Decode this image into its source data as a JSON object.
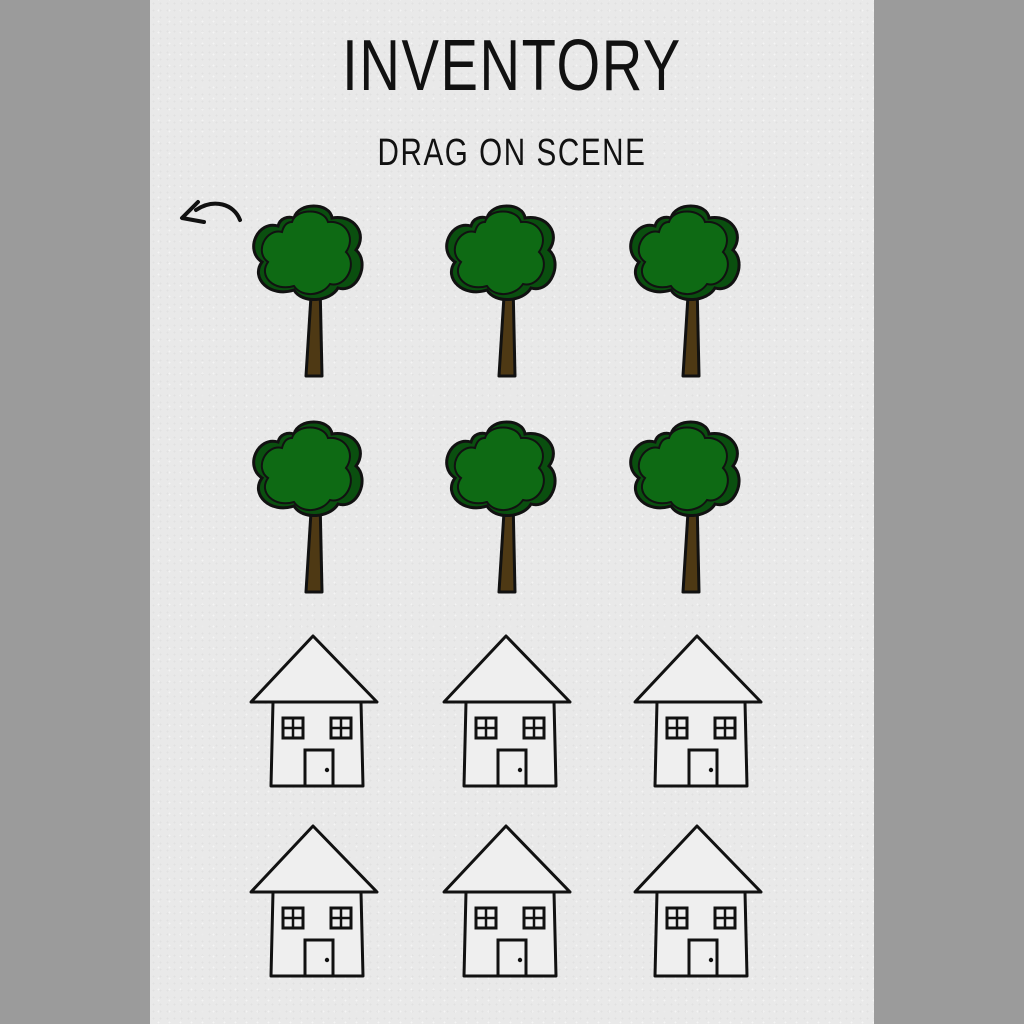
{
  "header": {
    "title": "INVENTORY",
    "subtitle": "DRAG ON SCENE"
  },
  "back_button": {
    "icon": "curved-back-arrow-icon"
  },
  "colors": {
    "background_outer": "#9b9b9b",
    "panel": "#e9e9e9",
    "tree_foliage": "#0e6a14",
    "tree_foliage_shadow": "#0a4f0f",
    "tree_trunk": "#4e3914",
    "outline": "#111111",
    "house_fill": "#efefef"
  },
  "inventory": {
    "items": [
      {
        "type": "tree",
        "icon": "tree-icon"
      },
      {
        "type": "tree",
        "icon": "tree-icon"
      },
      {
        "type": "tree",
        "icon": "tree-icon"
      },
      {
        "type": "tree",
        "icon": "tree-icon"
      },
      {
        "type": "tree",
        "icon": "tree-icon"
      },
      {
        "type": "tree",
        "icon": "tree-icon"
      },
      {
        "type": "house",
        "icon": "house-icon"
      },
      {
        "type": "house",
        "icon": "house-icon"
      },
      {
        "type": "house",
        "icon": "house-icon"
      },
      {
        "type": "house",
        "icon": "house-icon"
      },
      {
        "type": "house",
        "icon": "house-icon"
      },
      {
        "type": "house",
        "icon": "house-icon"
      }
    ]
  }
}
